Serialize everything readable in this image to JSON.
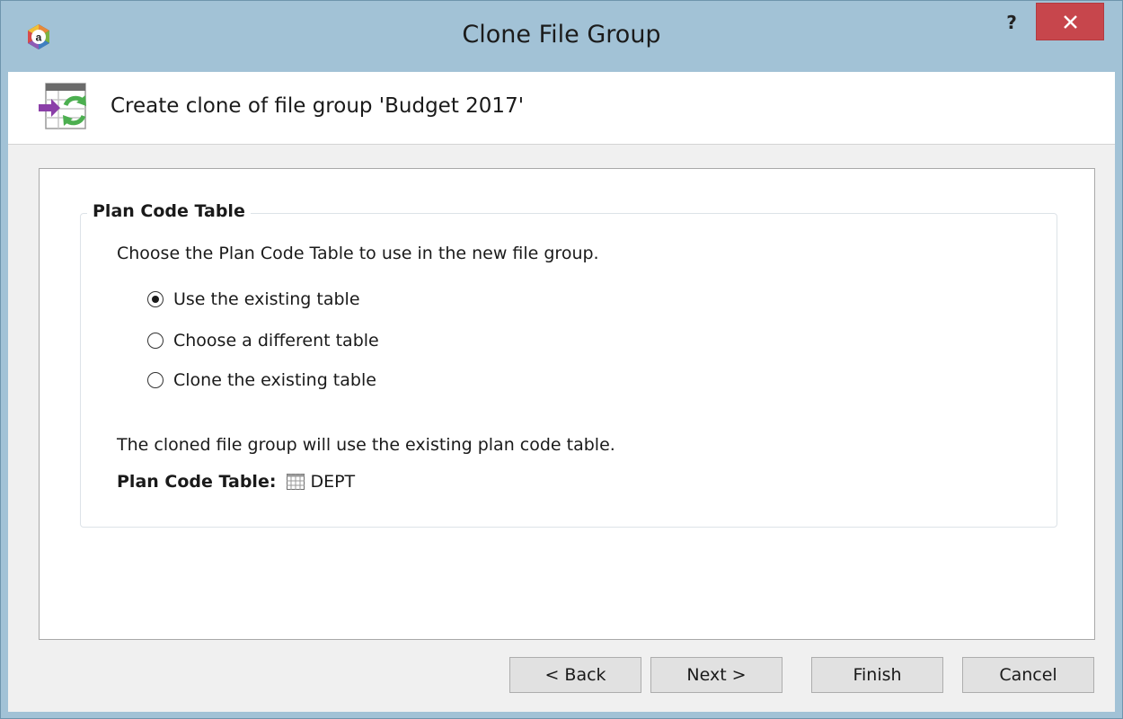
{
  "window": {
    "title": "Clone File Group",
    "help_label": "?"
  },
  "header": {
    "text": "Create clone of file group 'Budget 2017'"
  },
  "group": {
    "legend": "Plan Code Table",
    "instruction": "Choose the Plan Code Table to use in the new file group.",
    "options": [
      {
        "label": "Use the existing table",
        "checked": true
      },
      {
        "label": "Choose a different table",
        "checked": false
      },
      {
        "label": "Clone the existing table",
        "checked": false
      }
    ],
    "description": "The cloned file group will use the existing plan code table.",
    "plan_code_label": "Plan Code Table:",
    "plan_code_value": "DEPT"
  },
  "buttons": {
    "back": "< Back",
    "next": "Next >",
    "finish": "Finish",
    "cancel": "Cancel"
  },
  "colors": {
    "titlebar": "#a2c2d6",
    "close_button": "#c7464c",
    "dialog_background": "#f0f0f0",
    "panel_background": "#ffffff"
  },
  "icons": {
    "app": "axiom-logo-icon",
    "header": "clone-file-group-icon",
    "table": "table-grid-icon",
    "close": "close-icon"
  }
}
